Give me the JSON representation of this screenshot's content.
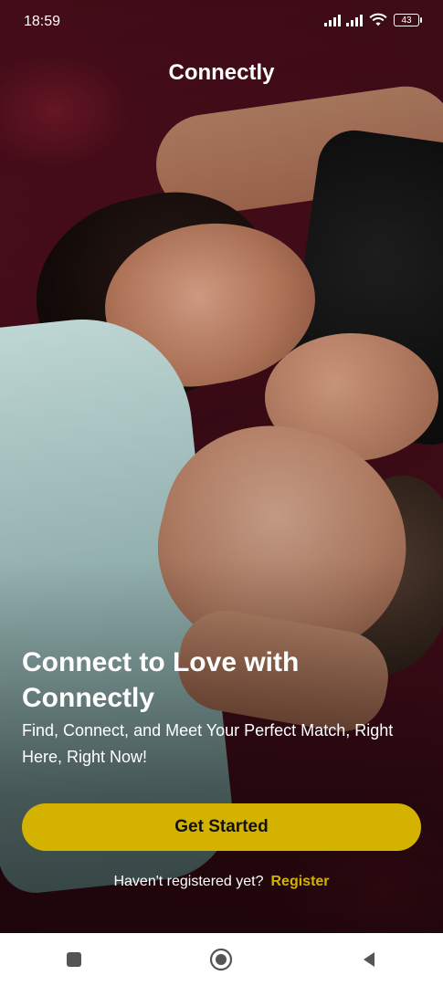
{
  "status_bar": {
    "time": "18:59",
    "battery": "43",
    "icons": [
      "signal-icon",
      "signal-icon",
      "wifi-icon",
      "battery-icon"
    ]
  },
  "app": {
    "title": "Connectly"
  },
  "hero": {
    "headline": "Connect to Love with Connectly",
    "subtext": "Find, Connect, and Meet Your Perfect Match, Right Here, Right Now!"
  },
  "actions": {
    "get_started": "Get Started",
    "register_prompt": "Haven't registered yet?",
    "register_link": "Register"
  },
  "navigation": {
    "icons": [
      "recent-apps-icon",
      "home-icon",
      "back-icon"
    ]
  },
  "colors": {
    "accent": "#d4b200",
    "text": "#ffffff",
    "navbar": "#ffffff"
  }
}
